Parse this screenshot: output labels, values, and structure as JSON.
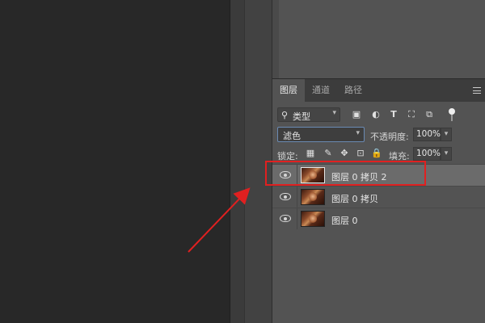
{
  "panel": {
    "tabs": [
      {
        "label": "图层",
        "active": true
      },
      {
        "label": "通道",
        "active": false
      },
      {
        "label": "路径",
        "active": false
      }
    ]
  },
  "filter": {
    "kind_label": "类型",
    "icons": [
      "image-filter-icon",
      "adjustment-filter-icon",
      "type-filter-icon",
      "shape-filter-icon",
      "smart-object-filter-icon"
    ]
  },
  "blend": {
    "mode": "滤色",
    "opacity_label": "不透明度:",
    "opacity_value": "100%"
  },
  "lock": {
    "label": "锁定:",
    "fill_label": "填充:",
    "fill_value": "100%"
  },
  "layers": [
    {
      "name": "图层 0 拷贝 2",
      "selected": true
    },
    {
      "name": "图层 0 拷贝",
      "selected": false
    },
    {
      "name": "图层 0",
      "selected": false
    }
  ],
  "annotation": {
    "highlight_color": "#e02020"
  }
}
